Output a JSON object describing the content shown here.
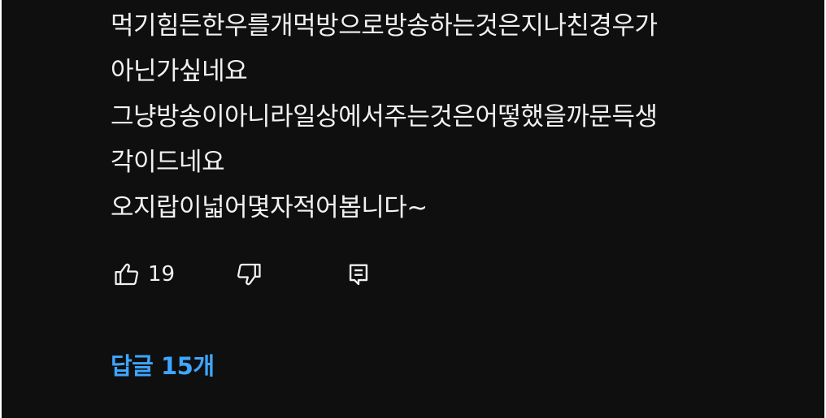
{
  "comment": {
    "lines": [
      "먹기힘든한우를개먹방으로방송하는것은지나친경우가",
      "아닌가싶네요",
      "그냥방송이아니라일상에서주는것은어떻했을까문득생",
      "각이드네요",
      "오지랍이넓어몇자적어봅니다~"
    ]
  },
  "actions": {
    "like_count": "19",
    "like_icon": "thumbs-up-icon",
    "dislike_icon": "thumbs-down-icon",
    "reply_icon": "comment-reply-icon"
  },
  "replies": {
    "label": "답글 15개",
    "color": "#3ea6ff"
  },
  "colors": {
    "background": "#0f0f0f",
    "text": "#f1f1f1"
  }
}
